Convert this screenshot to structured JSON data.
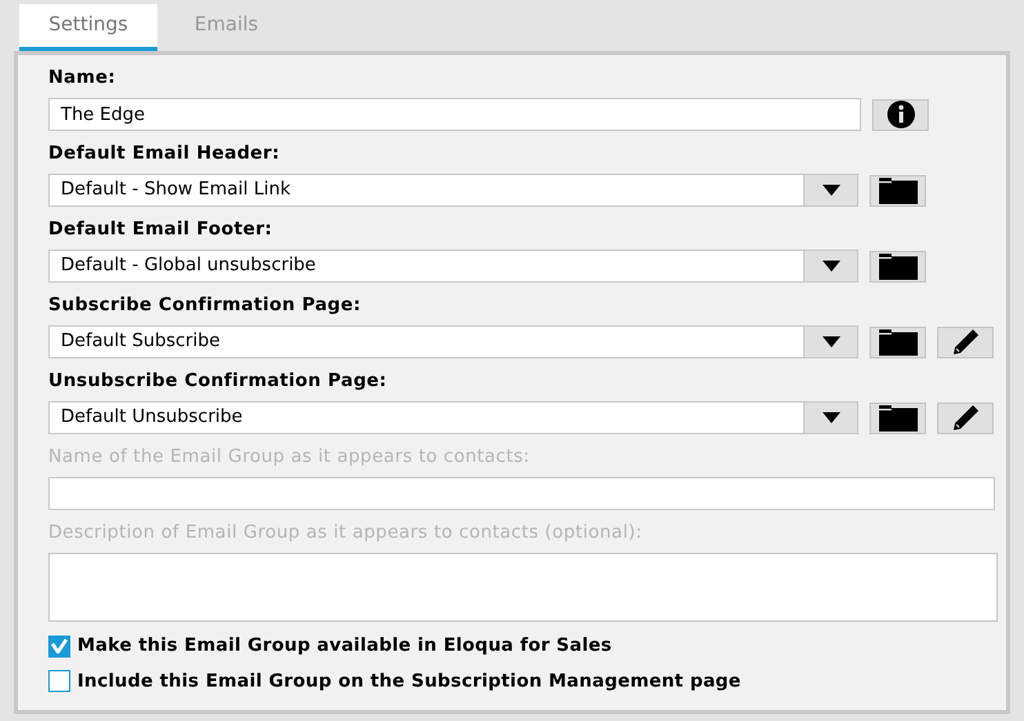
{
  "tabs": [
    {
      "label": "Settings",
      "selected": true
    },
    {
      "label": "Emails",
      "selected": false
    }
  ],
  "fields": [
    {
      "kind": "text",
      "label": "Name:",
      "value": "The Edge",
      "disabled": false,
      "actions": [
        {
          "kind": "info"
        }
      ]
    },
    {
      "kind": "select",
      "label": "Default Email Header:",
      "value": "Default - Show Email Link",
      "disabled": false,
      "actions": [
        {
          "kind": "folder"
        }
      ]
    },
    {
      "kind": "select",
      "label": "Default Email Footer:",
      "value": "Default - Global unsubscribe",
      "disabled": false,
      "actions": [
        {
          "kind": "folder"
        }
      ]
    },
    {
      "kind": "select",
      "label": "Subscribe Confirmation Page:",
      "value": "Default Subscribe",
      "disabled": false,
      "actions": [
        {
          "kind": "folder"
        },
        {
          "kind": "edit"
        }
      ]
    },
    {
      "kind": "select",
      "label": "Unsubscribe Confirmation Page:",
      "value": "Default Unsubscribe",
      "disabled": false,
      "actions": [
        {
          "kind": "folder"
        },
        {
          "kind": "edit"
        }
      ]
    },
    {
      "kind": "text",
      "label": "Name of the Email Group as it appears to contacts:",
      "disabled": true
    },
    {
      "kind": "textarea",
      "label": "Description of Email Group as it appears to contacts (optional):",
      "disabled": true
    }
  ],
  "checkboxes": [
    {
      "label": "Make this Email Group available in Eloqua for Sales",
      "checked": true
    },
    {
      "label": "Include this Email Group on the Subscription Management page",
      "checked": false
    }
  ]
}
